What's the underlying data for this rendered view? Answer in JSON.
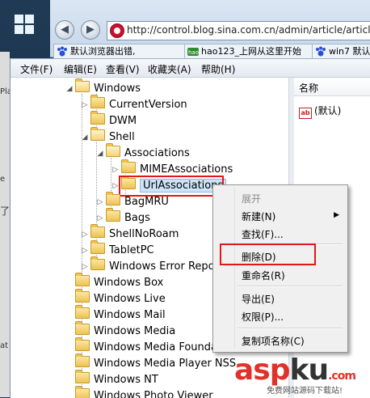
{
  "browser": {
    "url": "http://control.blog.sina.com.cn/admin/article/article_",
    "tabs": [
      "默认浏览器出错,",
      "hao123_上网从这里开始",
      "win7 默认"
    ],
    "left_strip_texts": [
      "Pla",
      "e",
      "了",
      "at"
    ]
  },
  "menubar": [
    "文件(F)",
    "编辑(E)",
    "查看(V)",
    "收藏夹(A)",
    "帮助(H)"
  ],
  "tree": [
    {
      "label": "Windows"
    },
    {
      "label": "CurrentVersion"
    },
    {
      "label": "DWM"
    },
    {
      "label": "Shell"
    },
    {
      "label": "Associations"
    },
    {
      "label": "MIMEAssociations"
    },
    {
      "label": "UrlAssociations"
    },
    {
      "label": "BagMRU"
    },
    {
      "label": "Bags"
    },
    {
      "label": "ShellNoRoam"
    },
    {
      "label": "TabletPC"
    },
    {
      "label": "Windows Error Reporting"
    },
    {
      "label": "Windows Box"
    },
    {
      "label": "Windows Live"
    },
    {
      "label": "Windows Mail"
    },
    {
      "label": "Windows Media"
    },
    {
      "label": "Windows Media Foundation"
    },
    {
      "label": "Windows Media Player NSS"
    },
    {
      "label": "Windows NT"
    },
    {
      "label": "Windows Photo Viewer"
    }
  ],
  "list": {
    "header": "名称",
    "rows": [
      "(默认)"
    ]
  },
  "context_menu": {
    "header": "展开",
    "items": [
      "新建(N)",
      "查找(F)...",
      "删除(D)",
      "重命名(R)",
      "导出(E)",
      "权限(P)...",
      "复制项名称(C)"
    ]
  },
  "watermark": {
    "brand": [
      "asp",
      "ku",
      ".com"
    ],
    "sub": "免费网站源码下载站!"
  }
}
